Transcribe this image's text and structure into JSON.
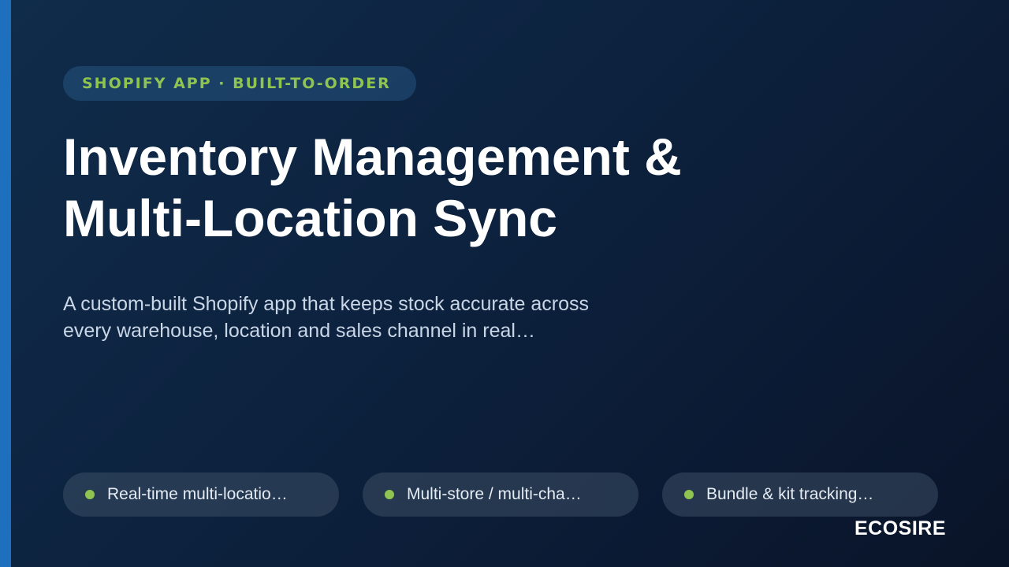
{
  "eyebrow": "SHOPIFY APP · BUILT-TO-ORDER",
  "title": {
    "line1": "Inventory Management &",
    "line2": "Multi-Location Sync"
  },
  "description": {
    "line1": "A custom-built Shopify app that keeps stock accurate across",
    "line2": "every warehouse, location and sales channel in real…"
  },
  "features": [
    {
      "label": "Real-time multi-locatio…"
    },
    {
      "label": "Multi-store / multi-cha…"
    },
    {
      "label": "Bundle & kit tracking…"
    }
  ],
  "brand": "ECOSIRE",
  "colors": {
    "accent": "#1f6fbf",
    "highlight": "#8fc450",
    "background": "#0d2340"
  }
}
